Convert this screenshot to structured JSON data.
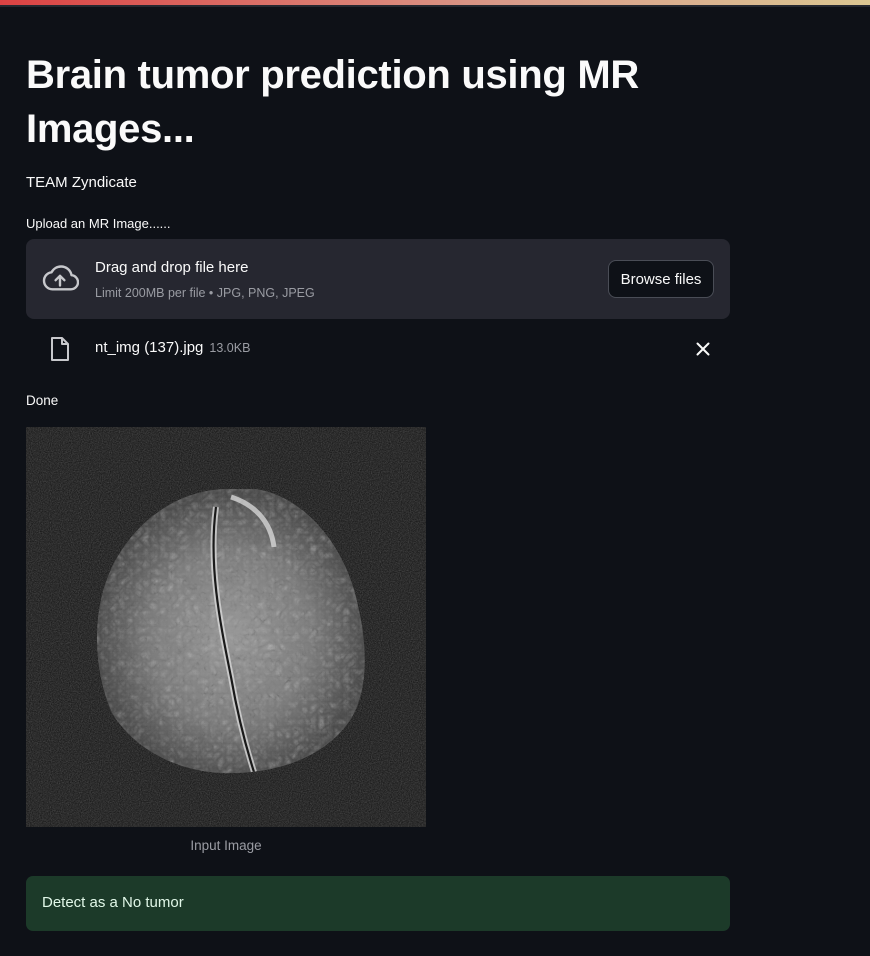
{
  "page": {
    "title": "Brain tumor prediction using MR Images...",
    "team": "TEAM Zyndicate"
  },
  "uploader": {
    "label": "Upload an MR Image......",
    "drop_title": "Drag and drop file here",
    "drop_subtitle": "Limit 200MB per file • JPG, PNG, JPEG",
    "browse_label": "Browse files",
    "cloud_icon": "cloud-upload-icon"
  },
  "file": {
    "name": "nt_img (137).jpg",
    "size": "13.0KB",
    "icon": "file-icon",
    "remove_icon": "close-icon"
  },
  "status": {
    "text": "Done"
  },
  "image": {
    "caption": "Input Image"
  },
  "result": {
    "text": "Detect as a No tumor",
    "color": "#1c3a29"
  },
  "colors": {
    "background": "#0e1117",
    "panel": "#262730",
    "accent": "#ff4b4b"
  }
}
